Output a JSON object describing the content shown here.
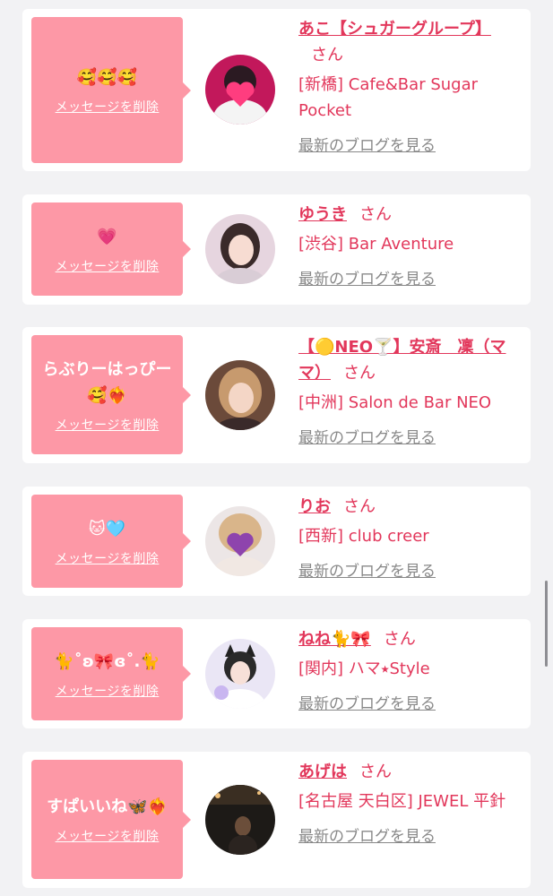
{
  "common": {
    "delete_label": "メッセージを削除",
    "blog_label": "最新のブログを見る",
    "honorific": "さん"
  },
  "colors": {
    "bubble": "#fd98a6",
    "accent": "#e2375b",
    "muted_link": "#888888",
    "background": "#f2f2f4"
  },
  "entries": [
    {
      "message": [
        "🥰🥰🥰"
      ],
      "name": "あこ【シュガーグループ】",
      "shop": "[新橋] Cafe&Bar Sugar Pocket",
      "avatar_icon": "pink-heart-sticker-photo"
    },
    {
      "message": [
        "💗"
      ],
      "name": "ゆうき",
      "shop": "[渋谷] Bar Aventure",
      "avatar_icon": "portrait-photo"
    },
    {
      "message": [
        "らぶりーはっぴー",
        "🥰❤️‍🔥"
      ],
      "name": "【🟡NEO🍸】安斎　凜（ママ）",
      "shop": "[中洲] Salon de Bar NEO",
      "avatar_icon": "portrait-photo"
    },
    {
      "message": [
        "🐱🩵"
      ],
      "name": "りお",
      "shop": "[西新] club creer",
      "avatar_icon": "purple-heart-sticker-photo"
    },
    {
      "message": [
        "🐈˚ʚ🎀ɞ˚.🐈"
      ],
      "name": "ねね🐈🎀",
      "shop": "[関内] ハマ⭑Style",
      "avatar_icon": "cat-ear-portrait-photo"
    },
    {
      "message": [
        "すぱいいね🦋❤️‍🔥"
      ],
      "name": "あげは",
      "shop": "[名古屋 天白区] JEWEL 平針",
      "avatar_icon": "night-street-photo"
    }
  ]
}
